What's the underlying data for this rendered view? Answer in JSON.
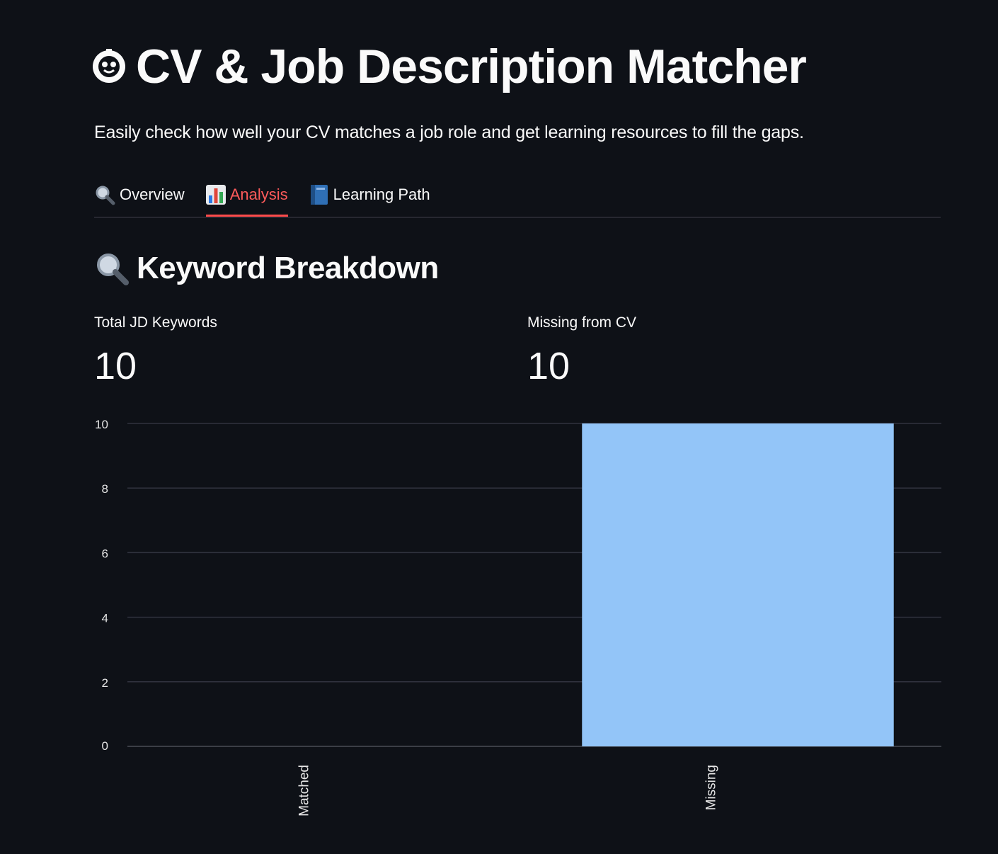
{
  "app": {
    "title": "CV & Job Description Matcher",
    "title_icon": "robot-face-icon",
    "subtitle": "Easily check how well your CV matches a job role and get learning resources to fill the gaps."
  },
  "tabs": [
    {
      "label": "Overview",
      "icon": "magnifier-icon",
      "active": false
    },
    {
      "label": "Analysis",
      "icon": "bar-chart-icon",
      "active": true
    },
    {
      "label": "Learning Path",
      "icon": "book-icon",
      "active": false
    }
  ],
  "section": {
    "heading": "Keyword Breakdown",
    "icon": "magnifier-icon"
  },
  "metrics": [
    {
      "label": "Total JD Keywords",
      "value": "10"
    },
    {
      "label": "Missing from CV",
      "value": "10"
    }
  ],
  "colors": {
    "background": "#0e1117",
    "accent": "#ff4b4b",
    "bar": "#93c5f8",
    "grid": "#31333f"
  },
  "chart_data": {
    "type": "bar",
    "categories": [
      "Matched",
      "Missing"
    ],
    "values": [
      0,
      10
    ],
    "ylim": [
      0,
      10
    ],
    "yticks": [
      0,
      2,
      4,
      6,
      8,
      10
    ],
    "xlabel": "",
    "ylabel": "",
    "grid": true,
    "x_tick_rotation": -90
  }
}
